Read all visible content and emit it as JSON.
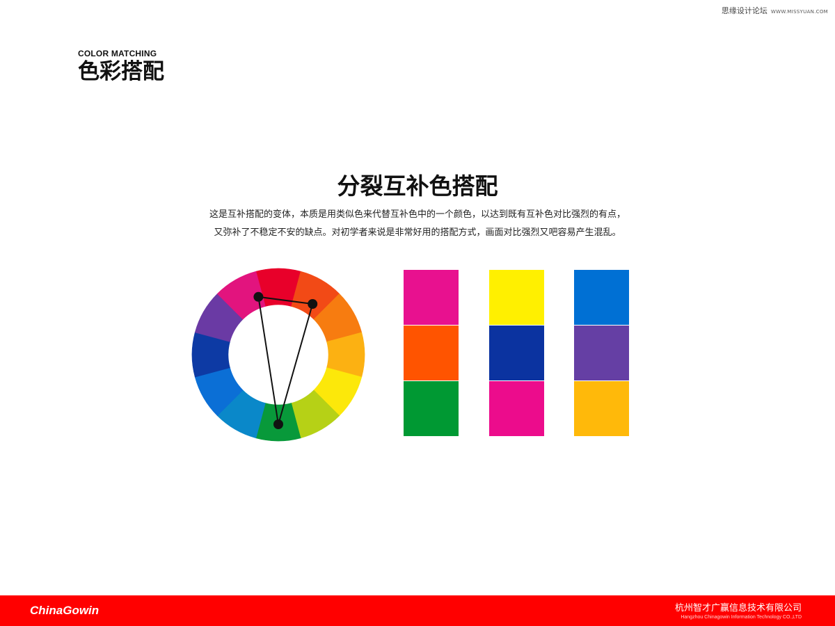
{
  "watermark": {
    "site_name": "思缘设计论坛",
    "site_url": "WWW.MISSYUAN.COM"
  },
  "header": {
    "title_en": "COLOR MATCHING",
    "title_cn": "色彩搭配"
  },
  "content": {
    "title": "分裂互补色搭配",
    "desc_line1": "这是互补搭配的变体，本质是用类似色来代替互补色中的一个颜色，以达到既有互补色对比强烈的有点，",
    "desc_line2": "又弥补了不稳定不安的缺点。对初学者来说是非常好用的搭配方式，画面对比强烈又吧容易产生混乱。"
  },
  "color_wheel": {
    "segments": [
      "#e8002a",
      "#f24a16",
      "#f77c10",
      "#fcb112",
      "#fce80a",
      "#b6d116",
      "#08993a",
      "#0a88c9",
      "#0b6fd6",
      "#0d3aa4",
      "#6a3aa4",
      "#e2147e"
    ],
    "triangle_color": "#111111",
    "selected_segments": [
      0,
      1,
      6
    ]
  },
  "swatches": [
    {
      "colors": [
        "#e8118f",
        "#ff5400",
        "#009933"
      ]
    },
    {
      "colors": [
        "#fff000",
        "#0b33a0",
        "#ec0c8c"
      ]
    },
    {
      "colors": [
        "#0070d4",
        "#653fa4",
        "#ffb90a"
      ]
    }
  ],
  "footer": {
    "logo": "ChinaGowin",
    "company_cn": "杭州智才广赢信息技术有限公司",
    "company_en": "Hangzhou Chinagowin Information Technology CO.,LTD",
    "bar_color": "#ff0000"
  }
}
